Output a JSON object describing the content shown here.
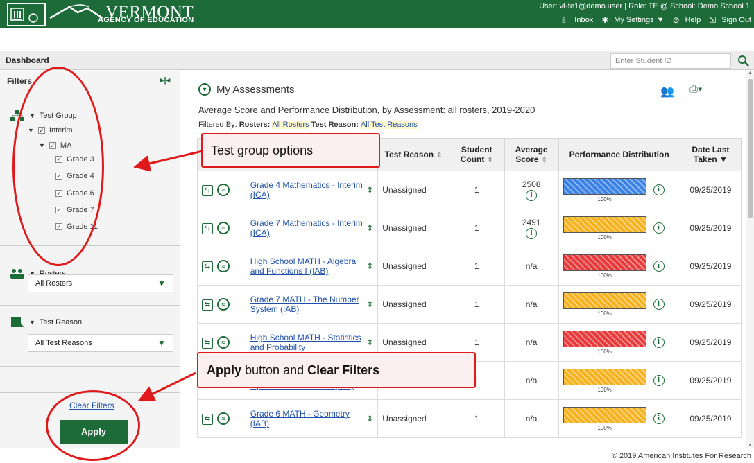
{
  "header": {
    "logo_name": "VERMONT",
    "logo_sub": "AGENCY OF EDUCATION",
    "user_line": "User: vt-te1@demo.user  |  Role: TE @ School: Demo School 1",
    "inbox": "Inbox",
    "settings": "My Settings",
    "help": "Help",
    "signout": "Sign Out",
    "brand_color": "#1e6b3a"
  },
  "dashbar": {
    "title": "Dashboard",
    "student_placeholder": "Enter Student ID"
  },
  "sidebar": {
    "title": "Filters",
    "test_group": {
      "label": "Test Group",
      "interim": "Interim",
      "ma": "MA",
      "grades": [
        "Grade 3",
        "Grade 4",
        "Grade 6",
        "Grade 7",
        "Grade 11"
      ]
    },
    "rosters": {
      "label": "Rosters",
      "value": "All Rosters"
    },
    "test_reason": {
      "label": "Test Reason",
      "value": "All Test Reasons"
    },
    "clear_filters": "Clear Filters",
    "apply": "Apply"
  },
  "main": {
    "title": "My Assessments",
    "subtitle": "Average Score and Performance Distribution, by Assessment: all rosters, 2019-2020",
    "filtered_prefix": "Filtered By: ",
    "filtered_rosters_label": "Rosters: ",
    "filtered_rosters_value": "All Rosters",
    "filtered_reason_label": " Test Reason: ",
    "filtered_reason_value": "All Test Reasons",
    "columns": {
      "reason": "Test Reason",
      "count": "Student Count",
      "score": "Average Score",
      "perf": "Performance Distribution",
      "date": "Date Last Taken"
    },
    "rows": [
      {
        "name": "Grade 4 Mathematics - Interim (ICA)",
        "reason": "Unassigned",
        "count": "1",
        "score": "2508",
        "has_info": true,
        "pct": "100%",
        "color": "#3b82e6",
        "date": "09/25/2019"
      },
      {
        "name": "Grade 7 Mathematics - Interim (ICA)",
        "reason": "Unassigned",
        "count": "1",
        "score": "2491",
        "has_info": true,
        "pct": "100%",
        "color": "#f5b21e",
        "date": "09/25/2019"
      },
      {
        "name": "High School MATH - Algebra and Functions I (IAB)",
        "reason": "Unassigned",
        "count": "1",
        "score": "n/a",
        "has_info": false,
        "pct": "100%",
        "color": "#e83a3a",
        "date": "09/25/2019"
      },
      {
        "name": "Grade 7 MATH - The Number System (IAB)",
        "reason": "Unassigned",
        "count": "1",
        "score": "n/a",
        "has_info": false,
        "pct": "100%",
        "color": "#f5b21e",
        "date": "09/25/2019"
      },
      {
        "name": "High School MATH - Statistics and Probability",
        "reason": "Unassigned",
        "count": "1",
        "score": "n/a",
        "has_info": false,
        "pct": "100%",
        "color": "#e83a3a",
        "date": "09/25/2019"
      },
      {
        "name": "Grade 3 MATH - Number and Operations - Fractions (IAB)",
        "reason": "Unassigned",
        "count": "1",
        "score": "n/a",
        "has_info": false,
        "pct": "100%",
        "color": "#f5b21e",
        "date": "09/25/2019"
      },
      {
        "name": "Grade 6 MATH - Geometry (IAB)",
        "reason": "Unassigned",
        "count": "1",
        "score": "n/a",
        "has_info": false,
        "pct": "100%",
        "color": "#f5b21e",
        "date": "09/25/2019"
      }
    ]
  },
  "annotations": {
    "callout1": "Test group options",
    "callout2_apply": "Apply",
    "callout2_mid": " button and ",
    "callout2_clear": "Clear Filters"
  },
  "footer": {
    "copyright": "© 2019 American Institutes For Research"
  }
}
